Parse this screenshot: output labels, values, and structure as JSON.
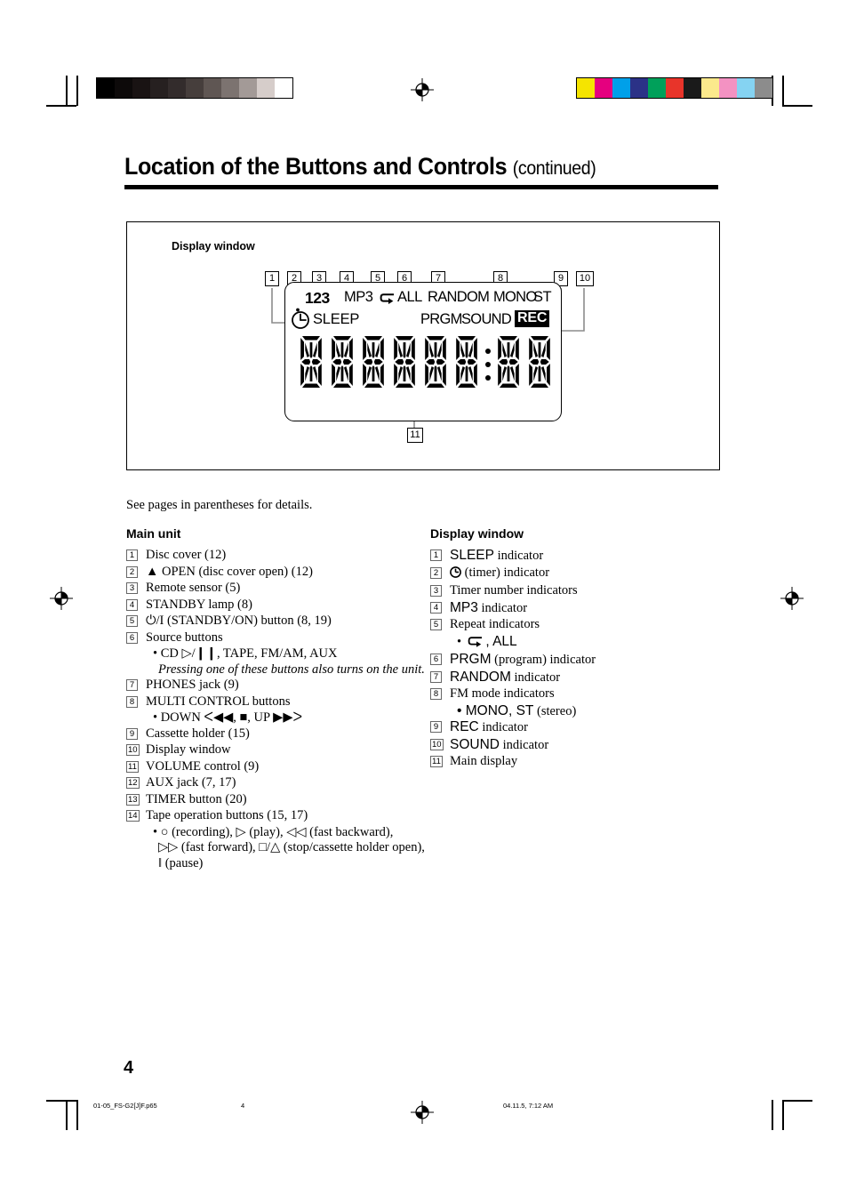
{
  "header": {
    "title": "Location of the Buttons and Controls",
    "continued": "(continued)"
  },
  "figure": {
    "caption": "Display window",
    "callouts": [
      "1",
      "2",
      "3",
      "4",
      "5",
      "6",
      "7",
      "8",
      "9",
      "10"
    ],
    "callout_main": "11",
    "indicators": {
      "timer_numbers": "123",
      "mp3": "MP3",
      "repeat_all": "ALL",
      "random": "RANDOM",
      "mono": "MONO",
      "stereo": "ST",
      "sleep": "SLEEP",
      "prgm": "PRGM",
      "sound": "SOUND",
      "rec": "REC"
    },
    "main_display": {
      "character_count": 8,
      "colon_after_character": 6
    }
  },
  "note": "See pages in parentheses for details.",
  "main_unit": {
    "heading": "Main unit",
    "items": [
      {
        "num": "1",
        "text": "Disc cover (12)"
      },
      {
        "num": "2",
        "text": "▲ OPEN (disc cover open) (12)"
      },
      {
        "num": "3",
        "text": "Remote sensor (5)"
      },
      {
        "num": "4",
        "text": "STANDBY lamp (8)"
      },
      {
        "num": "5",
        "text": "⏻/I (STANDBY/ON) button (8, 19)"
      },
      {
        "num": "6",
        "text": "Source buttons"
      },
      {
        "num": "7",
        "text": "PHONES jack (9)"
      },
      {
        "num": "8",
        "text": "MULTI CONTROL buttons"
      },
      {
        "num": "9",
        "text": "Cassette holder (15)"
      },
      {
        "num": "10",
        "text": "Display window"
      },
      {
        "num": "11",
        "text": "VOLUME control (9)"
      },
      {
        "num": "12",
        "text": "AUX jack (7, 17)"
      },
      {
        "num": "13",
        "text": "TIMER button (20)"
      },
      {
        "num": "14",
        "text": "Tape operation buttons (15, 17)"
      }
    ],
    "sub_6_a": "• CD ▷/❙❙, TAPE, FM/AM, AUX",
    "sub_6_b": "Pressing one of these buttons also turns on the unit.",
    "sub_8_a": "• DOWN ᐸ◀◀, ■, UP ▶▶ᐳ",
    "sub_14_a": "• ○ (recording), ▷ (play), ◁◁ (fast backward),",
    "sub_14_b": "▷▷ (fast forward), □/△ (stop/cassette holder open),",
    "sub_14_c": "‖ (pause)"
  },
  "display_window": {
    "heading": "Display window",
    "items": [
      {
        "num": "1",
        "text": "SLEEP indicator",
        "sans_prefix": "SLEEP",
        "rest": " indicator"
      },
      {
        "num": "2",
        "text": "⊕ (timer) indicator"
      },
      {
        "num": "3",
        "text": "Timer number indicators"
      },
      {
        "num": "4",
        "text": "MP3 indicator",
        "sans_prefix": "MP3",
        "rest": " indicator"
      },
      {
        "num": "5",
        "text": "Repeat indicators"
      },
      {
        "num": "6",
        "text": "PRGM (program) indicator",
        "sans_prefix": "PRGM",
        "rest": " (program) indicator"
      },
      {
        "num": "7",
        "text": "RANDOM indicator",
        "sans_prefix": "RANDOM",
        "rest": " indicator"
      },
      {
        "num": "8",
        "text": "FM mode indicators"
      },
      {
        "num": "9",
        "text": "REC indicator",
        "sans_prefix": "REC",
        "rest": " indicator"
      },
      {
        "num": "10",
        "text": "SOUND indicator",
        "sans_prefix": "SOUND",
        "rest": " indicator"
      },
      {
        "num": "11",
        "text": "Main display"
      }
    ],
    "sub_5": ", ALL",
    "sub_8": "• MONO, ST",
    "sub_8_rest": " (stereo)"
  },
  "page_number": "4",
  "footer": {
    "filename": "01-05_FS-G2[J]F.p65",
    "page": "4",
    "timestamp": "04.11.5, 7:12 AM"
  },
  "calibration": {
    "grayscale": [
      "#000000",
      "#0d0a0a",
      "#191313",
      "#262020",
      "#332c2c",
      "#463e3c",
      "#5f5653",
      "#7c7370",
      "#a39a97",
      "#d6cdca",
      "#ffffff"
    ],
    "colors": [
      "#f5e400",
      "#e5007f",
      "#00a0e9",
      "#2b3287",
      "#00a05a",
      "#e8342a",
      "#1a1a1a",
      "#fbe98c",
      "#f392c2",
      "#85d3f2",
      "#8c8c8c"
    ]
  }
}
